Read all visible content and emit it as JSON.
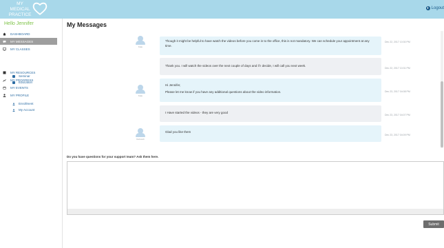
{
  "header": {
    "logo_text": "MY MEDICAL PRACTICE",
    "logout_label": "Logout",
    "background": "#a8d8ea"
  },
  "sidebar": {
    "greeting": "Hello Jennifer",
    "items": [
      {
        "label": "DASHBOARD",
        "icon": "home-icon"
      },
      {
        "label": "MY MESSAGES",
        "icon": "chat-icon",
        "active": true
      },
      {
        "label": "MY CLASSES",
        "icon": "monitor-icon"
      },
      {
        "label": "MY RESOURCES",
        "icon": "book-icon"
      },
      {
        "label": "MY PROGRESS",
        "icon": "chart-icon"
      },
      {
        "label": "MY EVENTS",
        "icon": "calendar-icon"
      },
      {
        "label": "MY PROFILE",
        "icon": "user-icon"
      }
    ],
    "classes_sub": [
      {
        "label": "Seminar",
        "icon": "video-icon"
      },
      {
        "label": "Education",
        "icon": "video-icon"
      }
    ],
    "profile_sub": [
      {
        "label": "Enrollment",
        "icon": "person-icon"
      },
      {
        "label": "My Account",
        "icon": "person-icon"
      }
    ]
  },
  "main": {
    "title": "My Messages",
    "messages": [
      {
        "sender": "support",
        "avatar_name": "Kate",
        "text": "Though it might be helpful to have watch the videos before you come in to the office, this is not mandatory. We can schedule your appointment at any time.",
        "time": "Dec 22, 2017 10:30 PM"
      },
      {
        "sender": "user",
        "avatar_name": "",
        "text": "Thank you. I will watch the videos over the next couple of days and if I decide, I will call you next week.",
        "time": "Dec 22, 2017 10:31 PM"
      },
      {
        "sender": "support",
        "avatar_name": "Kate",
        "line1": "Hi Jennifer,",
        "text": "Please let me know if you have any additional questions about the video information.",
        "time": "Dec 23, 2017 04:08 PM"
      },
      {
        "sender": "user",
        "avatar_name": "",
        "text": "I Have started the videos - they are very good",
        "time": "Dec 23, 2017 04:07 PM"
      },
      {
        "sender": "support",
        "avatar_name": "Deborah",
        "text": "Glad you like them",
        "time": "Dec 23, 2017 04:09 PM"
      }
    ],
    "ask_label": "Do you have questions for your support team? Ask them here.",
    "textarea_value": "",
    "submit_label": "Submit"
  }
}
